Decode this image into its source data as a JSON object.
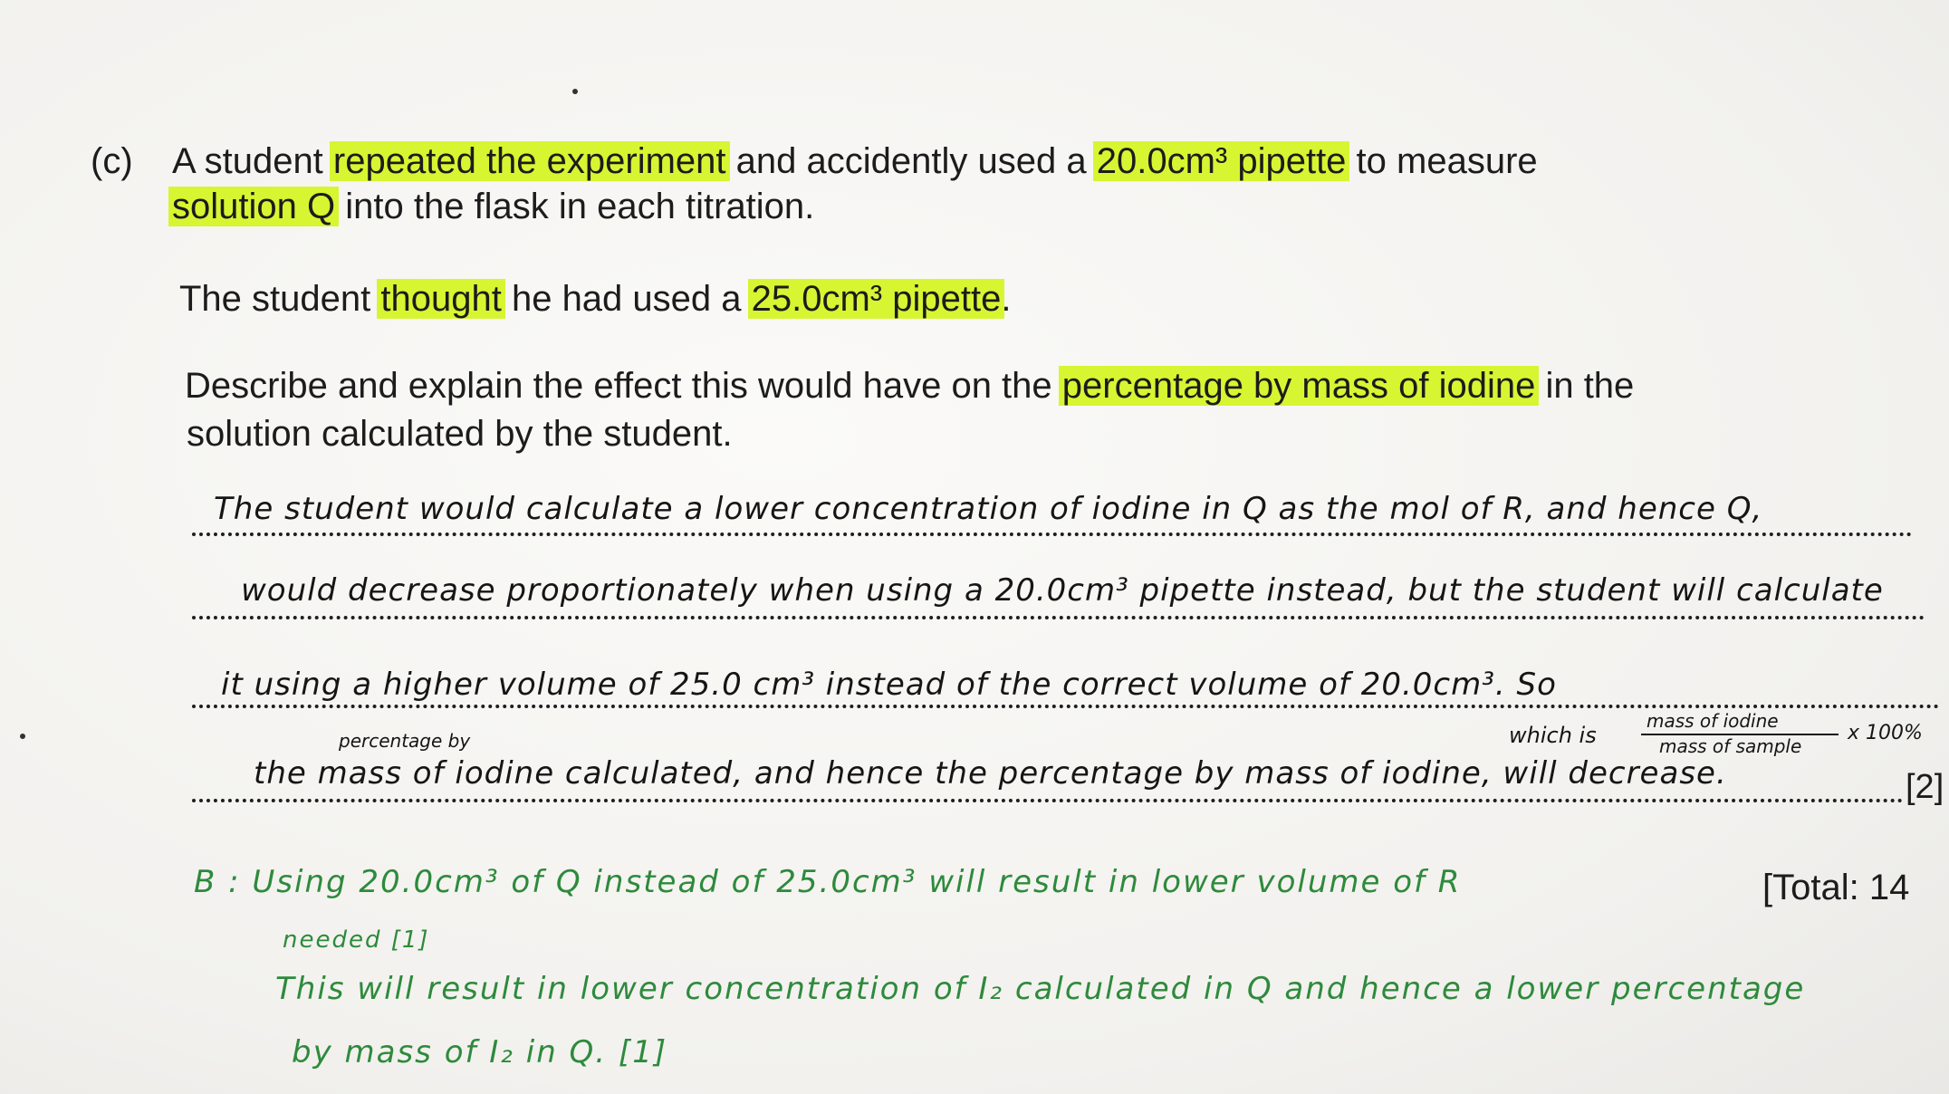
{
  "question": {
    "label": "(c)",
    "line1_a": "A student ",
    "line1_hl1": "repeated the experiment",
    "line1_b": " and accidently used a ",
    "line1_hl2": "20.0cm³ pipette",
    "line1_c": " to measure",
    "line2_hl": "solution Q",
    "line2_b": " into the flask in each titration.",
    "line3_a": "The student ",
    "line3_hl1": "thought",
    "line3_b": " he had used a ",
    "line3_hl2": "25.0cm³ pipette",
    "line3_c": ".",
    "line4_a": "Describe and explain the effect this would have on the ",
    "line4_hl": "percentage by mass of iodine",
    "line4_b": " in the",
    "line5": "solution calculated by the student."
  },
  "answer": {
    "line1": "The student would calculate a lower concentration of iodine in Q as the mol of R, and hence Q,",
    "line2": "would decrease proportionately when using a 20.0cm³ pipette instead, but the student will calculate",
    "line3": "it using a higher volume of 25.0 cm³ instead of the correct volume of 20.0cm³. So",
    "annotation_which": "which is",
    "annotation_fraction_top": "mass of iodine",
    "annotation_fraction_bottom": "mass of sample",
    "annotation_percent": "x 100%",
    "annotation_percentage": "percentage by",
    "line4": "the mass of iodine calculated, and hence the percentage by mass of iodine, will decrease.",
    "marks": "[2]"
  },
  "feedback": {
    "line1": "B : Using 20.0cm³ of Q instead of 25.0cm³ will result in lower volume of R",
    "line1b": "needed [1]",
    "line2": "This will result in lower concentration of I₂ calculated in Q and hence a lower percentage",
    "line3": "by mass of I₂ in Q. [1]"
  },
  "total": "[Total: 14",
  "colors": {
    "highlight": "#d8f532",
    "marking_pen": "#2e8a3c",
    "ink": "#151515"
  }
}
